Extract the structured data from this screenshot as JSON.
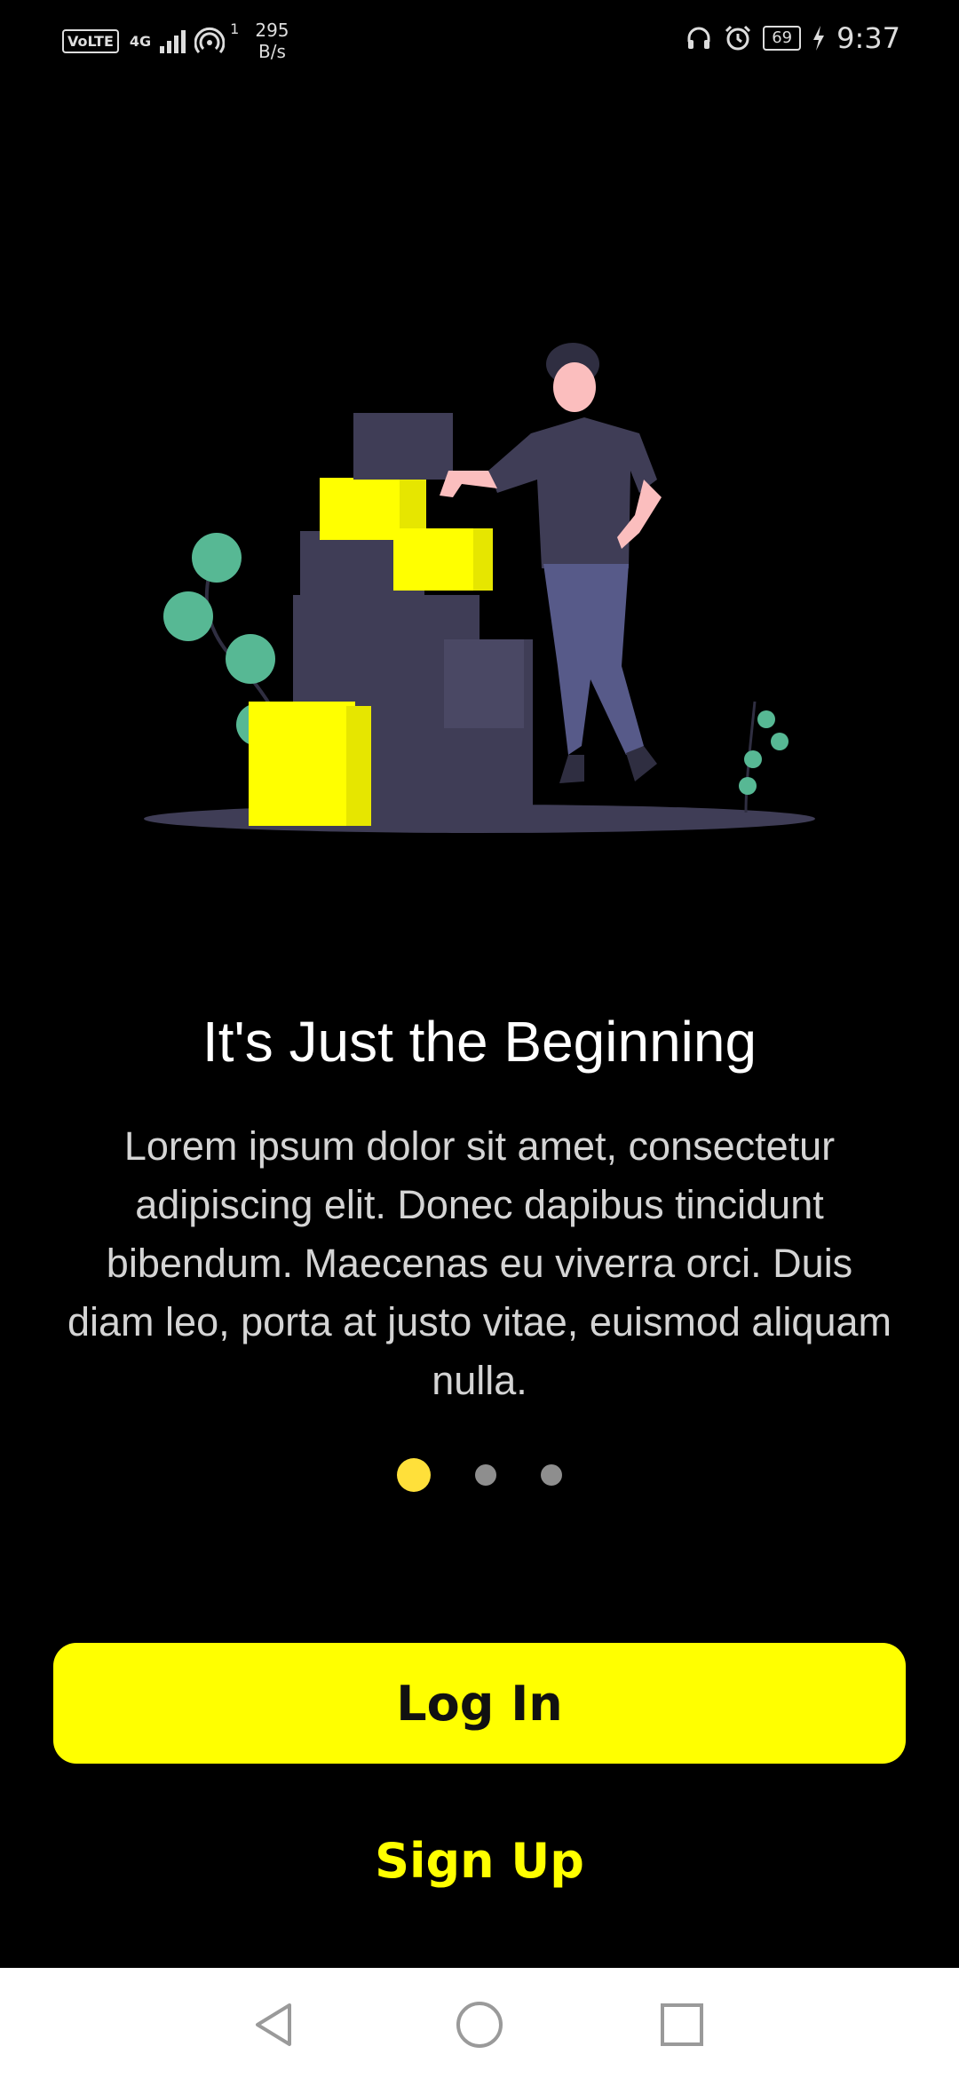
{
  "status_bar": {
    "volte": "VoLTE",
    "network": "4G",
    "hotspot_count": "1",
    "speed_value": "295",
    "speed_unit": "B/s",
    "battery": "69",
    "time": "9:37",
    "icons": [
      "headset-icon",
      "alarm-icon",
      "battery-icon",
      "charging-bolt-icon"
    ]
  },
  "onboarding": {
    "title": "It's Just the Beginning",
    "description": "Lorem ipsum dolor sit amet, consectetur adipiscing elit. Donec dapibus tincidunt bibendum. Maecenas eu viverra orci. Duis diam leo, porta at justo vitae, euismod aliquam nulla.",
    "page_indicator": {
      "current": 1,
      "total": 3
    }
  },
  "actions": {
    "login_label": "Log In",
    "signup_label": "Sign Up"
  },
  "colors": {
    "background": "#000000",
    "accent": "#ffff00",
    "active_dot": "#ffe03a",
    "inactive_dot": "#8e8e8e"
  },
  "nav_bar": {
    "icons": [
      "back-triangle-icon",
      "home-circle-icon",
      "recents-square-icon"
    ]
  }
}
